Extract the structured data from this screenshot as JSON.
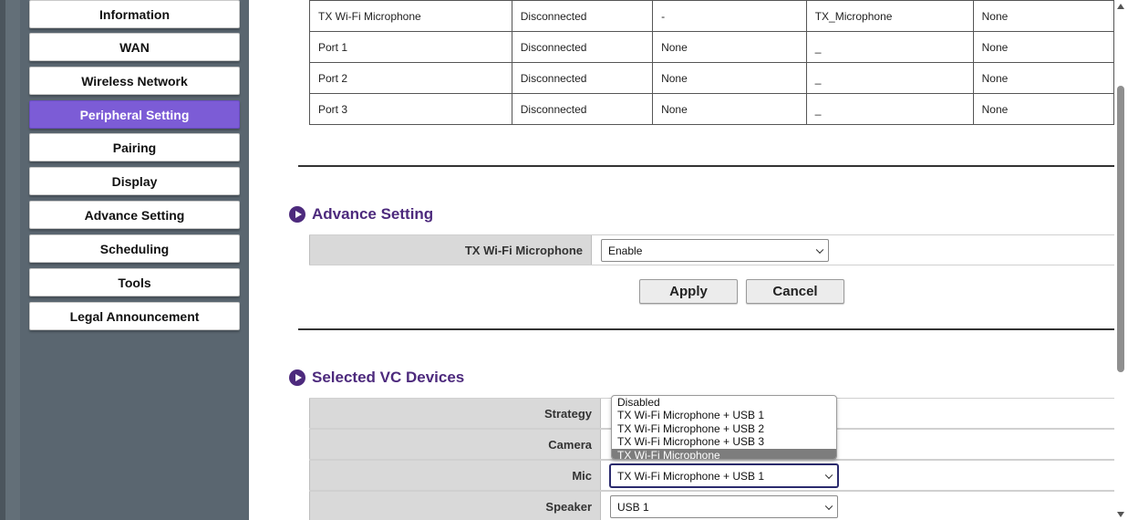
{
  "sidebar": {
    "items": [
      {
        "label": "Information",
        "active": false
      },
      {
        "label": "WAN",
        "active": false
      },
      {
        "label": "Wireless Network",
        "active": false
      },
      {
        "label": "Peripheral Setting",
        "active": true
      },
      {
        "label": "Pairing",
        "active": false
      },
      {
        "label": "Display",
        "active": false
      },
      {
        "label": "Advance Setting",
        "active": false
      },
      {
        "label": "Scheduling",
        "active": false
      },
      {
        "label": "Tools",
        "active": false
      },
      {
        "label": "Legal Announcement",
        "active": false
      }
    ]
  },
  "status_table": {
    "rows": [
      [
        "TX Wi-Fi Microphone",
        "Disconnected",
        "-",
        "TX_Microphone",
        "None"
      ],
      [
        "Port 1",
        "Disconnected",
        "None",
        "_",
        "None"
      ],
      [
        "Port 2",
        "Disconnected",
        "None",
        "_",
        "None"
      ],
      [
        "Port 3",
        "Disconnected",
        "None",
        "_",
        "None"
      ]
    ]
  },
  "advance_setting": {
    "title": "Advance Setting",
    "field_label": "TX Wi-Fi Microphone",
    "field_value": "Enable",
    "apply_label": "Apply",
    "cancel_label": "Cancel"
  },
  "selected_vc": {
    "title": "Selected VC Devices",
    "strategy_label": "Strategy",
    "camera_label": "Camera",
    "mic_label": "Mic",
    "mic_value": "TX Wi-Fi Microphone + USB 1",
    "speaker_label": "Speaker",
    "speaker_value": "USB 1",
    "dropdown_options": [
      {
        "label": "Disabled",
        "selected": false
      },
      {
        "label": "TX Wi-Fi Microphone + USB 1",
        "selected": false
      },
      {
        "label": "TX Wi-Fi Microphone + USB 2",
        "selected": false
      },
      {
        "label": "TX Wi-Fi Microphone + USB 3",
        "selected": false
      },
      {
        "label": "TX Wi-Fi Microphone",
        "selected": true
      }
    ]
  },
  "colors": {
    "sidebar_bg": "#5a6670",
    "active_item": "#7c5cd6",
    "section_title": "#4d2a7d"
  }
}
